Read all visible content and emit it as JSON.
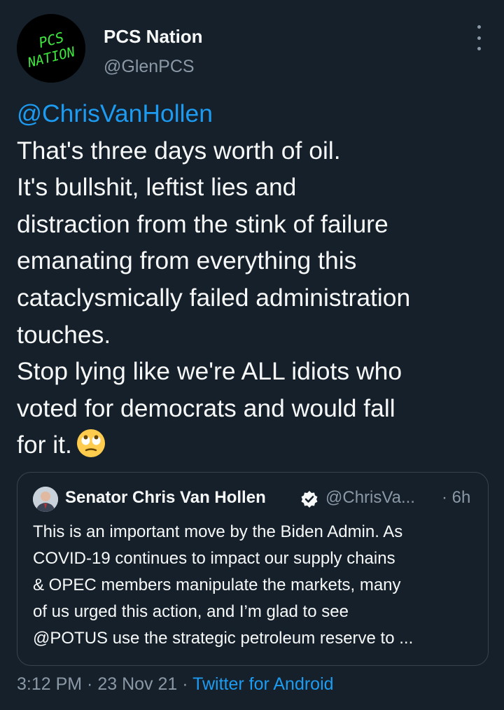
{
  "author": {
    "display_name": "PCS Nation",
    "handle": "@GlenPCS",
    "avatar_text_top": "PCS",
    "avatar_text_bottom": "NATION",
    "avatar_color": "#3ee83e"
  },
  "tweet": {
    "mention": "@ChrisVanHollen",
    "lines": [
      "That's three days worth of oil.",
      "It's bullshit, leftist lies and",
      "distraction from the stink of failure",
      "emanating from everything this",
      "cataclysmically failed administration",
      "touches.",
      "Stop lying like we're ALL idiots who",
      "voted for democrats and would fall",
      "for it."
    ],
    "emoji": "face-with-rolling-eyes-icon"
  },
  "quoted_tweet": {
    "display_name": "Senator Chris Van Hollen",
    "verified": true,
    "handle": "@ChrisVa...",
    "time": "· 6h",
    "lines": [
      "This is an important move by the Biden Admin. As",
      "COVID-19 continues to impact our supply chains",
      "& OPEC members manipulate the markets, many",
      "of us urged this action, and I’m glad to see",
      "@POTUS use the strategic petroleum reserve to ..."
    ]
  },
  "meta": {
    "time": "3:12 PM",
    "separator": " · ",
    "date": "23 Nov 21",
    "source": "Twitter for Android"
  },
  "colors": {
    "background": "#15202b",
    "accent": "#1d9bf0",
    "secondary_text": "#8b98a5",
    "border": "#38444d"
  }
}
